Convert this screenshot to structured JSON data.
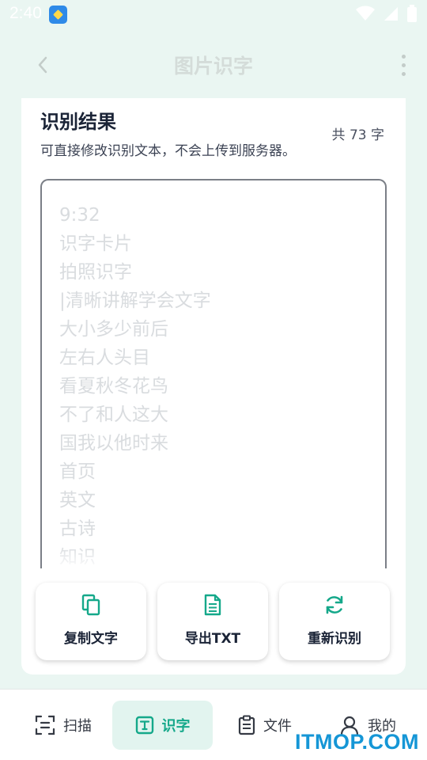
{
  "status_bar": {
    "time": "2:40"
  },
  "app_bar": {
    "title": "图片识字"
  },
  "result": {
    "title": "识别结果",
    "count": "共 73 字",
    "hint": "可直接修改识别文本，不会上传到服务器。",
    "lines": [
      "9:32",
      "识字卡片",
      "拍照识字",
      "|清晰讲解学会文字",
      "大小多少前后",
      "左右人头目",
      "看夏秋冬花鸟",
      "不了和人这大",
      "国我以他时来",
      "首页",
      "英文",
      "古诗",
      "知识"
    ]
  },
  "actions": [
    {
      "label": "复制文字",
      "icon": "copy-icon"
    },
    {
      "label": "导出TXT",
      "icon": "document-icon"
    },
    {
      "label": "重新识别",
      "icon": "refresh-icon"
    }
  ],
  "bottom_nav": [
    {
      "label": "扫描",
      "icon": "scan-icon",
      "active": false
    },
    {
      "label": "识字",
      "icon": "text-recognition-icon",
      "active": true
    },
    {
      "label": "文件",
      "icon": "file-icon",
      "active": false
    },
    {
      "label": "我的",
      "icon": "profile-icon",
      "active": false
    }
  ],
  "watermark": "ITMOP.COM",
  "colors": {
    "accent": "#15a88a",
    "background": "#eaf6f2",
    "watermark": "#1596d6"
  }
}
